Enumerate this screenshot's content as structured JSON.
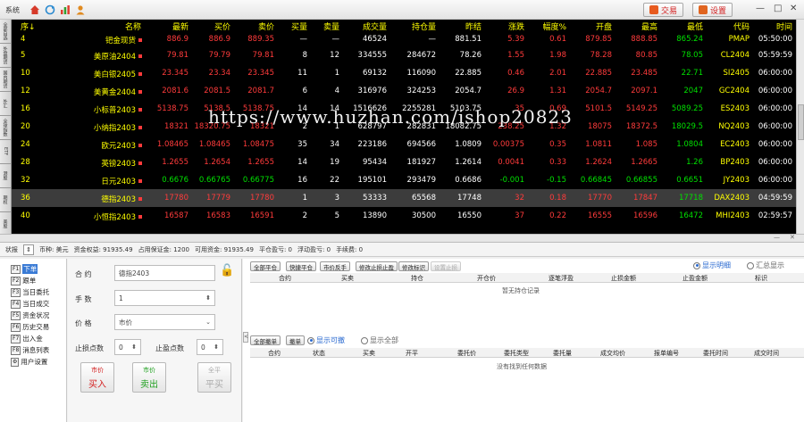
{
  "topbar": {
    "system_label": "系统",
    "trade_button": "交易",
    "settings_button": "设置",
    "window_controls": [
      "—",
      "□",
      "✕"
    ]
  },
  "side_tabs": [
    "全部自选",
    "外盘期货",
    "国内期货",
    "外汇",
    "全球指数",
    "ETF",
    "港股",
    "期权",
    "美股"
  ],
  "quote_table": {
    "headers": [
      "序↓",
      "名称",
      "最新",
      "买价",
      "卖价",
      "买量",
      "卖量",
      "成交量",
      "持仓量",
      "昨结",
      "涨跌",
      "幅度%",
      "开盘",
      "最高",
      "最低",
      "代码",
      "时间"
    ],
    "rows": [
      {
        "seq": "4",
        "name": "钯金现货",
        "last": "886.9",
        "bid": "886.9",
        "ask": "889.35",
        "bidv": "—",
        "askv": "—",
        "vol": "46524",
        "oi": "—",
        "prev": "881.51",
        "chg": "5.39",
        "pct": "0.61",
        "open": "879.85",
        "high": "888.85",
        "low": "865.24",
        "code": "PMAP",
        "time": "05:50:00"
      },
      {
        "seq": "5",
        "name": "美原油2404",
        "last": "79.81",
        "bid": "79.79",
        "ask": "79.81",
        "bidv": "8",
        "askv": "12",
        "vol": "334555",
        "oi": "284672",
        "prev": "78.26",
        "chg": "1.55",
        "pct": "1.98",
        "open": "78.28",
        "high": "80.85",
        "low": "78.05",
        "code": "CL2404",
        "time": "05:59:59"
      },
      {
        "seq": "10",
        "name": "美白银2405",
        "last": "23.345",
        "bid": "23.34",
        "ask": "23.345",
        "bidv": "11",
        "askv": "1",
        "vol": "69132",
        "oi": "116090",
        "prev": "22.885",
        "chg": "0.46",
        "pct": "2.01",
        "open": "22.885",
        "high": "23.485",
        "low": "22.71",
        "code": "SI2405",
        "time": "06:00:00"
      },
      {
        "seq": "12",
        "name": "美黄金2404",
        "last": "2081.6",
        "bid": "2081.5",
        "ask": "2081.7",
        "bidv": "6",
        "askv": "4",
        "vol": "316976",
        "oi": "324253",
        "prev": "2054.7",
        "chg": "26.9",
        "pct": "1.31",
        "open": "2054.7",
        "high": "2097.1",
        "low": "2047",
        "code": "GC2404",
        "time": "06:00:00"
      },
      {
        "seq": "16",
        "name": "小标普2403",
        "last": "5138.75",
        "bid": "5138.5",
        "ask": "5138.75",
        "bidv": "14",
        "askv": "14",
        "vol": "1516626",
        "oi": "2255281",
        "prev": "5103.75",
        "chg": "35",
        "pct": "0.69",
        "open": "5101.5",
        "high": "5149.25",
        "low": "5089.25",
        "code": "ES2403",
        "time": "06:00:00"
      },
      {
        "seq": "20",
        "name": "小纳指2403",
        "last": "18321",
        "bid": "18320.75",
        "ask": "18321",
        "bidv": "2",
        "askv": "1",
        "vol": "628797",
        "oi": "282831",
        "prev": "18082.75",
        "chg": "238.25",
        "pct": "1.32",
        "open": "18075",
        "high": "18372.5",
        "low": "18029.5",
        "code": "NQ2403",
        "time": "06:00:00"
      },
      {
        "seq": "24",
        "name": "欧元2403",
        "last": "1.08465",
        "bid": "1.08465",
        "ask": "1.08475",
        "bidv": "35",
        "askv": "34",
        "vol": "223186",
        "oi": "694566",
        "prev": "1.0809",
        "chg": "0.00375",
        "pct": "0.35",
        "open": "1.0811",
        "high": "1.085",
        "low": "1.0804",
        "code": "EC2403",
        "time": "06:00:00"
      },
      {
        "seq": "28",
        "name": "英镑2403",
        "last": "1.2655",
        "bid": "1.2654",
        "ask": "1.2655",
        "bidv": "14",
        "askv": "19",
        "vol": "95434",
        "oi": "181927",
        "prev": "1.2614",
        "chg": "0.0041",
        "pct": "0.33",
        "open": "1.2624",
        "high": "1.2665",
        "low": "1.26",
        "code": "BP2403",
        "time": "06:00:00"
      },
      {
        "seq": "32",
        "name": "日元2403",
        "last": "0.6676",
        "bid": "0.66765",
        "ask": "0.66775",
        "bidv": "16",
        "askv": "22",
        "vol": "195101",
        "oi": "293479",
        "prev": "0.6686",
        "chg": "-0.001",
        "pct": "-0.15",
        "open": "0.66845",
        "high": "0.66855",
        "low": "0.6651",
        "code": "JY2403",
        "time": "06:00:00"
      },
      {
        "seq": "36",
        "name": "德指2403",
        "last": "17780",
        "bid": "17779",
        "ask": "17780",
        "bidv": "1",
        "askv": "3",
        "vol": "53333",
        "oi": "65568",
        "prev": "17748",
        "chg": "32",
        "pct": "0.18",
        "open": "17770",
        "high": "17847",
        "low": "17718",
        "code": "DAX2403",
        "time": "04:59:59"
      },
      {
        "seq": "40",
        "name": "小恒指2403",
        "last": "16587",
        "bid": "16583",
        "ask": "16591",
        "bidv": "2",
        "askv": "5",
        "vol": "13890",
        "oi": "30500",
        "prev": "16550",
        "chg": "37",
        "pct": "0.22",
        "open": "16555",
        "high": "16596",
        "low": "16472",
        "code": "MHI2403",
        "time": "02:59:57"
      }
    ]
  },
  "watermark": "https://www.huzhan.com/ishop20823",
  "status_bar": {
    "label": "状报",
    "currency": "币种: 美元",
    "equity": "资金权益: 91935.49",
    "margin": "占用保证金: 1200",
    "available": "可用资金: 91935.49",
    "close_pl": "平仓盈亏: 0",
    "float_pl": "浮动盈亏: 0",
    "fee": "手续费: 0"
  },
  "nav": [
    {
      "key": "F1",
      "label": "下单"
    },
    {
      "key": "F2",
      "label": "跟单"
    },
    {
      "key": "F3",
      "label": "当日委托"
    },
    {
      "key": "F4",
      "label": "当日成交"
    },
    {
      "key": "F5",
      "label": "资金状况"
    },
    {
      "key": "F6",
      "label": "历史交易"
    },
    {
      "key": "F7",
      "label": "出入金"
    },
    {
      "key": "F8",
      "label": "消息列表"
    },
    {
      "key": "⚙",
      "label": "用户设置"
    }
  ],
  "order": {
    "contract_label": "合  约",
    "contract_value": "德指2403",
    "qty_label": "手  数",
    "qty_value": "1",
    "price_label": "价  格",
    "price_value": "市价",
    "sl_label": "止损点数",
    "sl_value": "0",
    "tp_label": "止盈点数",
    "tp_value": "0",
    "buy_top": "市价",
    "buy_main": "买入",
    "sell_top": "市价",
    "sell_main": "卖出",
    "flat_top": "全平",
    "flat_main": "平买"
  },
  "positions": {
    "buttons": [
      "全部平仓",
      "快捷平仓",
      "市价反手",
      "修改止损止盈",
      "修改标识",
      "设置止损"
    ],
    "view_detail": "显示明细",
    "view_summary": "汇总显示",
    "headers": [
      "合约",
      "买卖",
      "持仓",
      "开仓价",
      "逐笔浮盈",
      "止损金额",
      "止盈金额",
      "标识"
    ],
    "empty": "暂无持仓记录"
  },
  "orders": {
    "buttons": [
      "全部撤单",
      "撤单"
    ],
    "show_cancelable": "显示可撤",
    "show_all": "显示全部",
    "headers": [
      "合约",
      "状态",
      "买卖",
      "开平",
      "委托价",
      "委托类型",
      "委托量",
      "成交均价",
      "报单编号",
      "委托时间",
      "成交时间"
    ],
    "empty": "没有找到任何数据"
  },
  "colors": {
    "up": "#ff3b3b",
    "down": "#00e000",
    "header": "#ffff00",
    "name": "#ffff00",
    "neutral": "#ffffff",
    "code": "#ffff00",
    "selected_row": "#3c3c3c"
  }
}
